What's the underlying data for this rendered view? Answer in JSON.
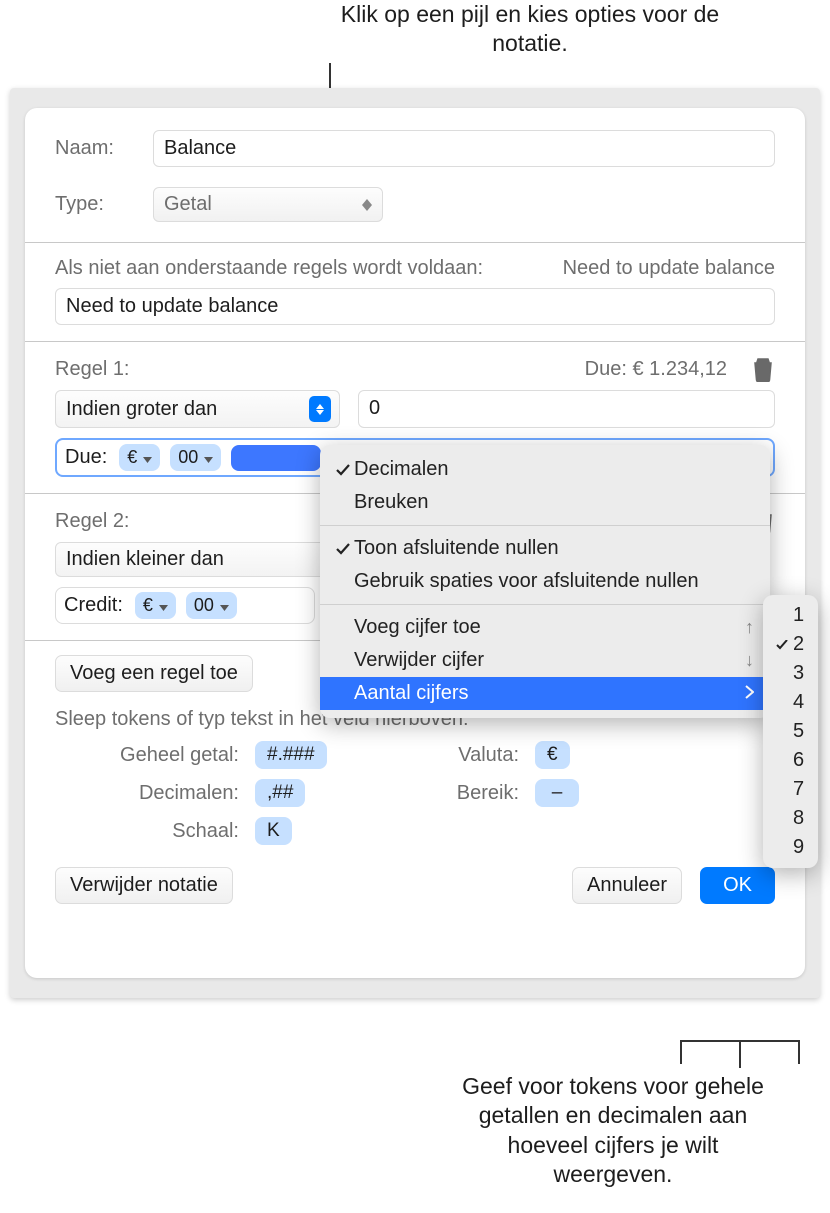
{
  "callouts": {
    "top": "Klik op een pijl en kies opties voor de notatie.",
    "bottom": "Geef voor tokens voor gehele getallen en decimalen aan hoeveel cijfers je wilt weergeven."
  },
  "form": {
    "name_label": "Naam:",
    "name_value": "Balance",
    "type_label": "Type:",
    "type_value": "Getal"
  },
  "fallback": {
    "label": "Als niet aan onderstaande regels wordt voldaan:",
    "preview": "Need to update balance",
    "value": "Need to update balance"
  },
  "rule1": {
    "title": "Regel 1:",
    "preview": "Due: € 1.234,12",
    "condition": "Indien groter dan",
    "value": "0",
    "token_prefix": "Due:",
    "tokens": [
      "€",
      "00"
    ]
  },
  "rule2": {
    "title": "Regel 2:",
    "condition": "Indien kleiner dan",
    "token_prefix": "Credit:",
    "tokens": [
      "€",
      "00"
    ]
  },
  "add_rule": "Voeg een regel toe",
  "hint": "Sleep tokens of typ tekst in het veld hierboven:",
  "token_grid": {
    "geheel_label": "Geheel getal:",
    "geheel_token": "#.###",
    "decimalen_label": "Decimalen:",
    "decimalen_token": ",##",
    "schaal_label": "Schaal:",
    "schaal_token": "K",
    "valuta_label": "Valuta:",
    "valuta_token": "€",
    "bereik_label": "Bereik:",
    "bereik_token": "–"
  },
  "footer": {
    "delete": "Verwijder notatie",
    "cancel": "Annuleer",
    "ok": "OK"
  },
  "menu": {
    "decimalen": "Decimalen",
    "breuken": "Breuken",
    "toon_nullen": "Toon afsluitende nullen",
    "spaties_nullen": "Gebruik spaties voor afsluitende nullen",
    "voeg_cijfer": "Voeg cijfer toe",
    "verwijder_cijfer": "Verwijder cijfer",
    "aantal_cijfers": "Aantal cijfers",
    "arrow_up": "↑",
    "arrow_down": "↓"
  },
  "submenu": {
    "options": [
      "1",
      "2",
      "3",
      "4",
      "5",
      "6",
      "7",
      "8",
      "9"
    ],
    "selected": "2"
  }
}
